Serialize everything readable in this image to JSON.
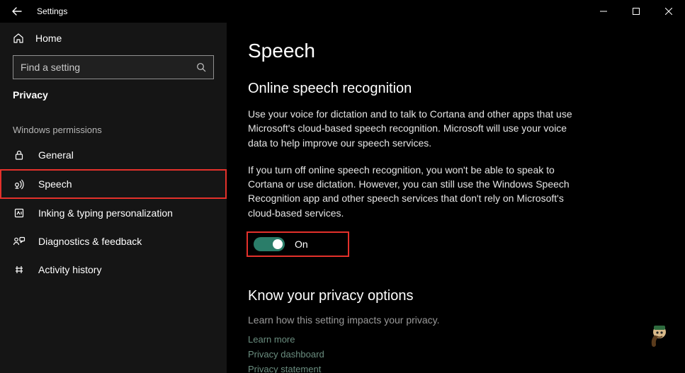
{
  "titlebar": {
    "title": "Settings"
  },
  "sidebar": {
    "home_label": "Home",
    "search_placeholder": "Find a setting",
    "category": "Privacy",
    "group_header": "Windows permissions",
    "items": [
      {
        "label": "General"
      },
      {
        "label": "Speech"
      },
      {
        "label": "Inking & typing personalization"
      },
      {
        "label": "Diagnostics & feedback"
      },
      {
        "label": "Activity history"
      }
    ]
  },
  "main": {
    "page_title": "Speech",
    "section_title": "Online speech recognition",
    "para1": "Use your voice for dictation and to talk to Cortana and other apps that use Microsoft's cloud-based speech recognition. Microsoft will use your voice data to help improve our speech services.",
    "para2": "If you turn off online speech recognition, you won't be able to speak to Cortana or use dictation. However, you can still use the Windows Speech Recognition app and other speech services that don't rely on Microsoft's cloud-based services.",
    "toggle_label": "On",
    "privacy_heading": "Know your privacy options",
    "privacy_sub": "Learn how this setting impacts your privacy.",
    "links": {
      "learn_more": "Learn more",
      "dashboard": "Privacy dashboard",
      "statement": "Privacy statement"
    }
  }
}
